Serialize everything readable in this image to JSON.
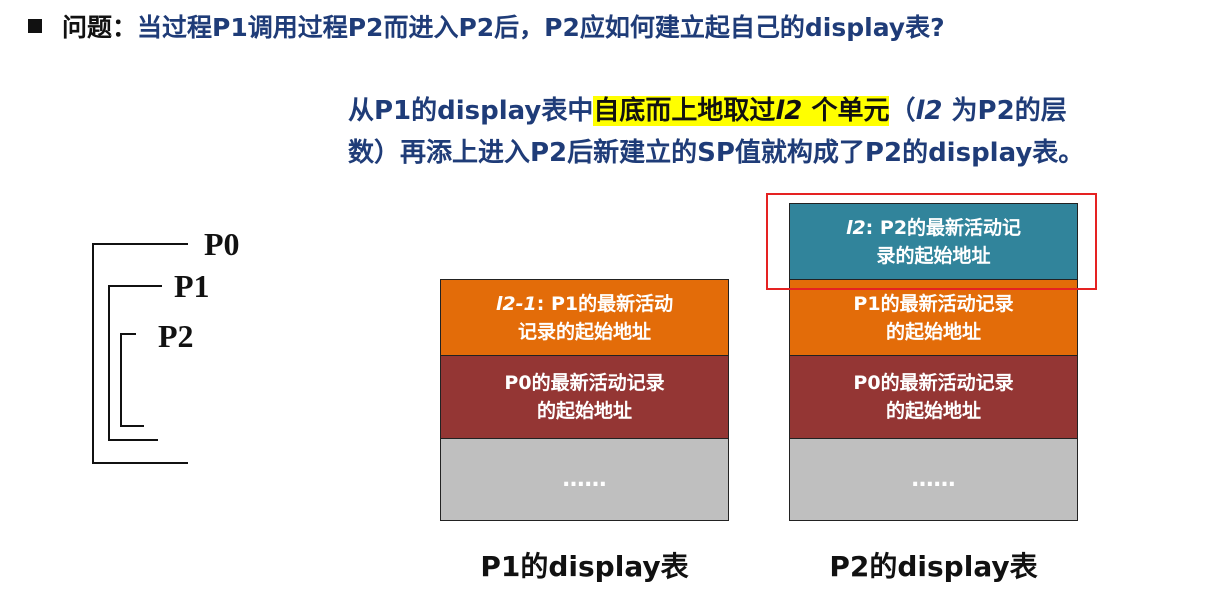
{
  "question": {
    "prefix": "问题：",
    "body": "当过程P1调用过程P2而进入P2后，P2应如何建立起自己的display表?"
  },
  "explanation": {
    "line1_a": "从P1的display表中",
    "line1_hl_a": "自底而上地取过",
    "line1_hl_var": "l2",
    "line1_hl_b": " 个单元",
    "line1_b": "（",
    "line1_var": "l2",
    "line1_c": " 为P2的层",
    "line2": "数）再添上进入P2后新建立的SP值就构成了P2的display表。"
  },
  "nesting": {
    "procedures": [
      "P0",
      "P1",
      "P2"
    ]
  },
  "tables": [
    {
      "label": "P1的display表",
      "cells": [
        {
          "var": "l2-1",
          "sep": ":  ",
          "l1": "P1的最新活动",
          "l2": "记录的起始地址",
          "color": "#e36c09"
        },
        {
          "var": "",
          "sep": "",
          "l1": "P0的最新活动记录",
          "l2": "的起始地址",
          "color": "#943634"
        },
        {
          "var": "",
          "sep": "",
          "l1": "……",
          "l2": "",
          "color": "#bfbfbf"
        }
      ]
    },
    {
      "label": "P2的display表",
      "cells": [
        {
          "var": "l2",
          "sep": ": ",
          "l1": "P2的最新活动记",
          "l2": "录的起始地址",
          "color": "#31849b"
        },
        {
          "var": "",
          "sep": "",
          "l1": "P1的最新活动记录",
          "l2": "的起始地址",
          "color": "#e36c09"
        },
        {
          "var": "",
          "sep": "",
          "l1": "P0的最新活动记录",
          "l2": "的起始地址",
          "color": "#943634"
        },
        {
          "var": "",
          "sep": "",
          "l1": "……",
          "l2": "",
          "color": "#bfbfbf"
        }
      ]
    }
  ],
  "colors": {
    "title_text": "#1f3c78",
    "highlight": "#ffff00",
    "new_entry_box": "#e52222"
  }
}
